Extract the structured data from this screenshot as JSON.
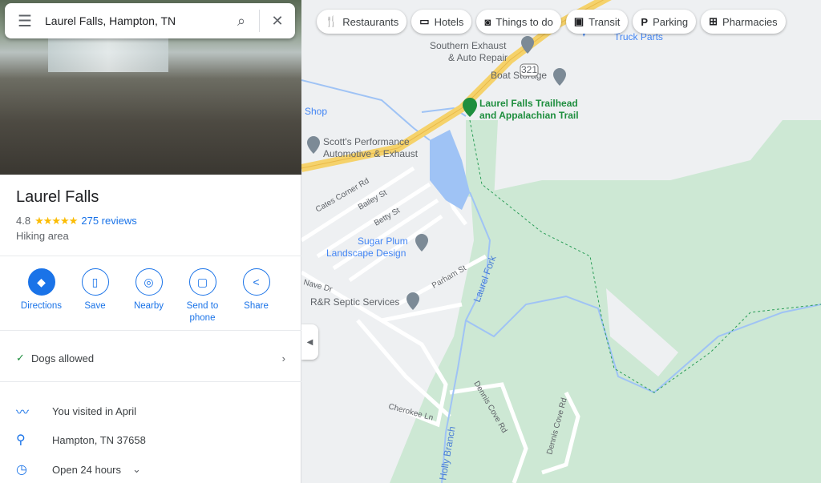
{
  "search": {
    "value": "Laurel Falls, Hampton, TN"
  },
  "place": {
    "name": "Laurel Falls",
    "rating": "4.8",
    "stars": "★★★★★",
    "reviews": "275 reviews",
    "category": "Hiking area"
  },
  "actions": [
    {
      "label": "Directions",
      "icon": "directions-icon"
    },
    {
      "label": "Save",
      "icon": "bookmark-icon"
    },
    {
      "label": "Nearby",
      "icon": "nearby-icon"
    },
    {
      "label": "Send to phone",
      "icon": "send-to-phone-icon"
    },
    {
      "label": "Share",
      "icon": "share-icon"
    }
  ],
  "amenity": {
    "label": "Dogs allowed"
  },
  "info": [
    {
      "icon": "timeline-icon",
      "text": "You visited in April"
    },
    {
      "icon": "location-pin-icon",
      "text": "Hampton, TN 37658"
    },
    {
      "icon": "clock-icon",
      "text": "Open 24 hours"
    }
  ],
  "chips": [
    {
      "label": "Restaurants",
      "icon": "fork-knife-icon"
    },
    {
      "label": "Hotels",
      "icon": "bed-icon"
    },
    {
      "label": "Things to do",
      "icon": "camera-icon"
    },
    {
      "label": "Transit",
      "icon": "train-icon"
    },
    {
      "label": "Parking",
      "icon": "parking-icon"
    },
    {
      "label": "Pharmacies",
      "icon": "pharmacy-icon"
    }
  ],
  "map": {
    "labels": {
      "truck": "Truck Parts",
      "southern1": "Southern Exhaust",
      "southern2": "& Auto Repair",
      "boat": "Boat Storage",
      "trail1": "Laurel Falls Trailhead",
      "trail2": "and Appalachian Trail",
      "shop": "Shop",
      "scott1": "Scott's Performance",
      "scott2": "Automotive & Exhaust",
      "cates": "Cates Corner Rd",
      "bailey": "Bailey St",
      "betty": "Betty St",
      "sugar1": "Sugar Plum",
      "sugar2": "Landscape Design",
      "parham": "Parham St",
      "nave": "Nave Dr",
      "rr": "R&R Septic Services",
      "laurelfork": "Laurel Fork",
      "dennis1": "Dennis Cove Rd",
      "dennis2": "Dennis Cove Rd",
      "cherokee": "Cherokee Ln",
      "holly": "Holly Branch",
      "route": "321"
    },
    "colors": {
      "park": "#cde8d4",
      "water": "#9fc3f5",
      "highway": "#f5d26b",
      "poi_green": "#1e8e3e",
      "poi_blue": "#4285f4"
    }
  }
}
